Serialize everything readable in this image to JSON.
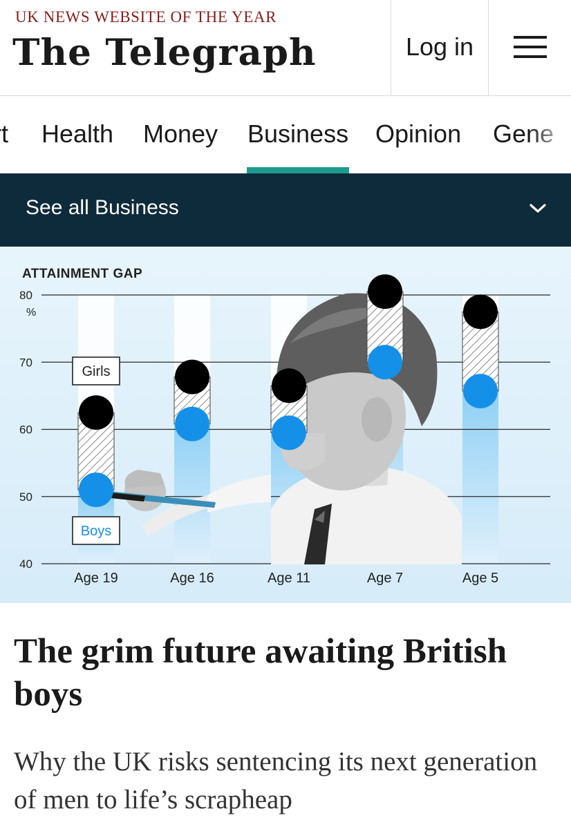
{
  "masthead": {
    "tagline": "UK NEWS WEBSITE OF THE YEAR",
    "logo": "The Telegraph",
    "login_label": "Log in",
    "menu_icon": "hamburger-icon"
  },
  "section_nav": {
    "items": [
      {
        "label": "rt",
        "active": false
      },
      {
        "label": "Health",
        "active": false
      },
      {
        "label": "Money",
        "active": false
      },
      {
        "label": "Business",
        "active": true
      },
      {
        "label": "Opinion",
        "active": false
      },
      {
        "label": "Gene",
        "active": false
      }
    ],
    "active_color": "#1c9c8f"
  },
  "subnav": {
    "label": "See all Business",
    "icon": "chevron-down-icon",
    "background": "#0e2b3b"
  },
  "chart_data": {
    "type": "scatter",
    "title": "ATTAINMENT GAP",
    "unit": "%",
    "ylim": [
      40,
      80
    ],
    "yticks": [
      "80",
      "70",
      "60",
      "50",
      "40"
    ],
    "categories": [
      "Age 19",
      "Age 16",
      "Age 11",
      "Age 7",
      "Age 5"
    ],
    "series": [
      {
        "name": "Girls",
        "color": "#000000",
        "values": [
          62.5,
          67.8,
          66.5,
          80.5,
          77.5
        ]
      },
      {
        "name": "Boys",
        "color": "#1590e8",
        "values": [
          51,
          60.8,
          59.5,
          70.0,
          65.7
        ]
      }
    ],
    "grid": true,
    "legend": "labels on first column"
  },
  "article": {
    "headline": "The grim future awaiting British boys",
    "standfirst": "Why the UK risks sentencing its next generation of men to life’s scrapheap"
  }
}
